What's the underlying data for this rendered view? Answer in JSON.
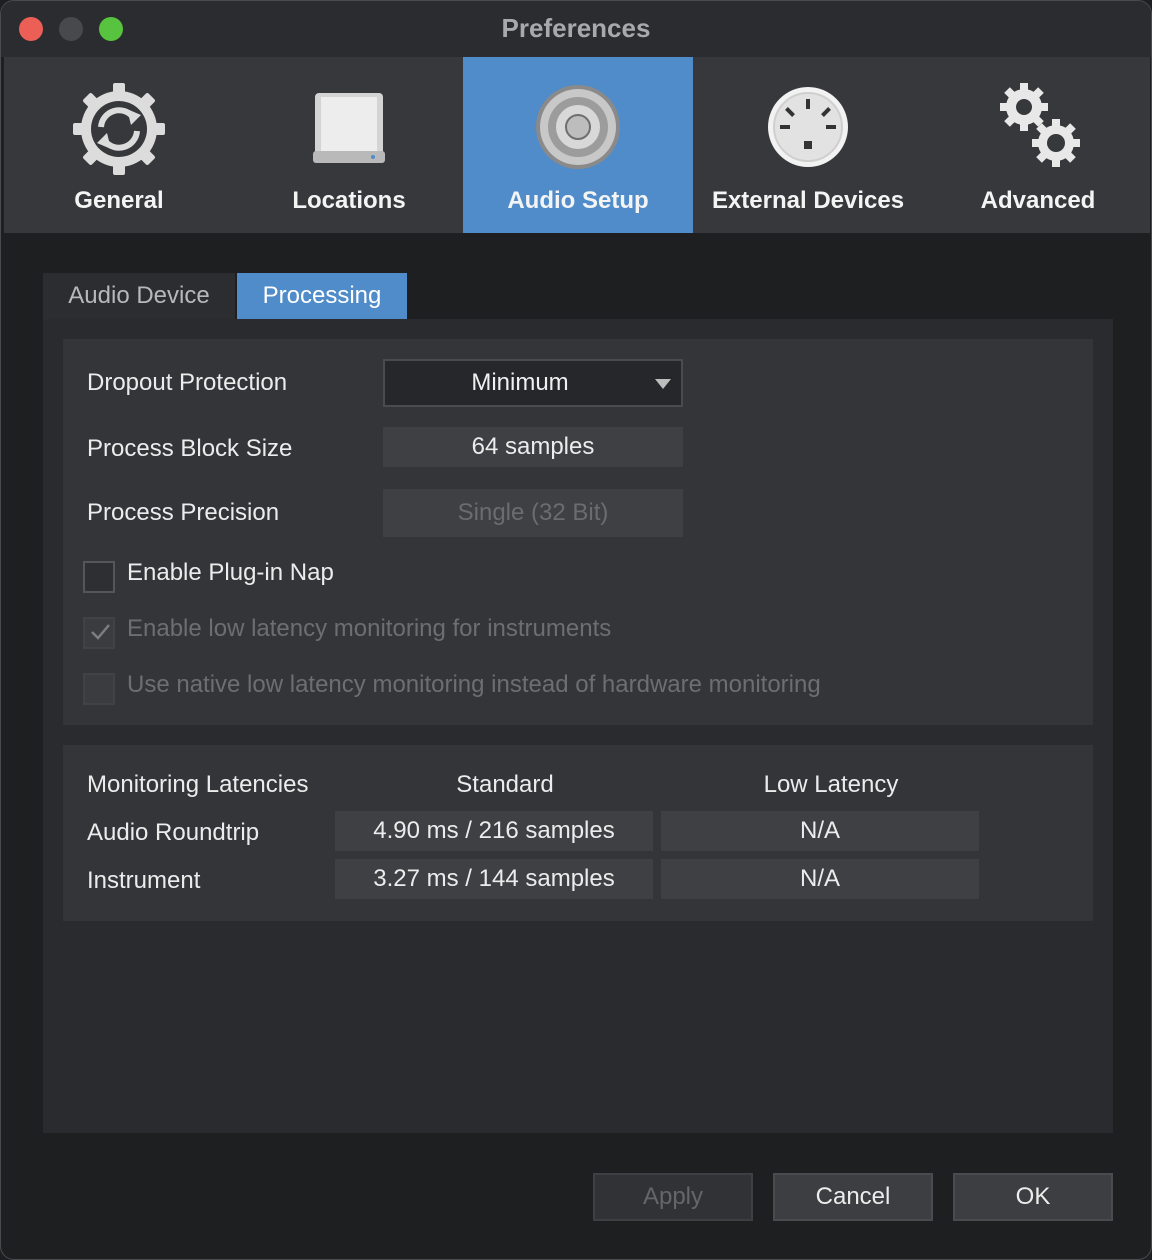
{
  "window": {
    "title": "Preferences",
    "buttons": [
      "close",
      "minimize",
      "maximize"
    ]
  },
  "toolbar": {
    "items": [
      {
        "label": "General",
        "icon": "sync-gear-icon",
        "active": false
      },
      {
        "label": "Locations",
        "icon": "hard-drive-icon",
        "active": false
      },
      {
        "label": "Audio Setup",
        "icon": "speaker-icon",
        "active": true
      },
      {
        "label": "External Devices",
        "icon": "midi-port-icon",
        "active": false
      },
      {
        "label": "Advanced",
        "icon": "gears-icon",
        "active": false
      }
    ]
  },
  "subtabs": {
    "items": [
      {
        "label": "Audio Device",
        "active": false
      },
      {
        "label": "Processing",
        "active": true
      }
    ]
  },
  "processing": {
    "dropout_protection": {
      "label": "Dropout Protection",
      "value": "Minimum"
    },
    "block_size": {
      "label": "Process Block Size",
      "value": "64 samples"
    },
    "precision": {
      "label": "Process Precision",
      "value": "Single (32 Bit)",
      "disabled": true
    },
    "options": [
      {
        "label": "Enable Plug-in Nap",
        "checked": false,
        "disabled": false
      },
      {
        "label": "Enable low latency monitoring for instruments",
        "checked": true,
        "disabled": true
      },
      {
        "label": "Use native low latency monitoring instead of hardware monitoring",
        "checked": false,
        "disabled": true
      }
    ]
  },
  "latencies": {
    "title": "Monitoring Latencies",
    "columns": [
      "Standard",
      "Low Latency"
    ],
    "rows": [
      {
        "label": "Audio Roundtrip",
        "standard": "4.90 ms / 216 samples",
        "low": "N/A"
      },
      {
        "label": "Instrument",
        "standard": "3.27 ms / 144 samples",
        "low": "N/A"
      }
    ]
  },
  "footer": {
    "apply": "Apply",
    "cancel": "Cancel",
    "ok": "OK"
  },
  "colors": {
    "accent": "#4f8cc9",
    "background": "#1e1f21",
    "panel": "#2a2b2e"
  }
}
